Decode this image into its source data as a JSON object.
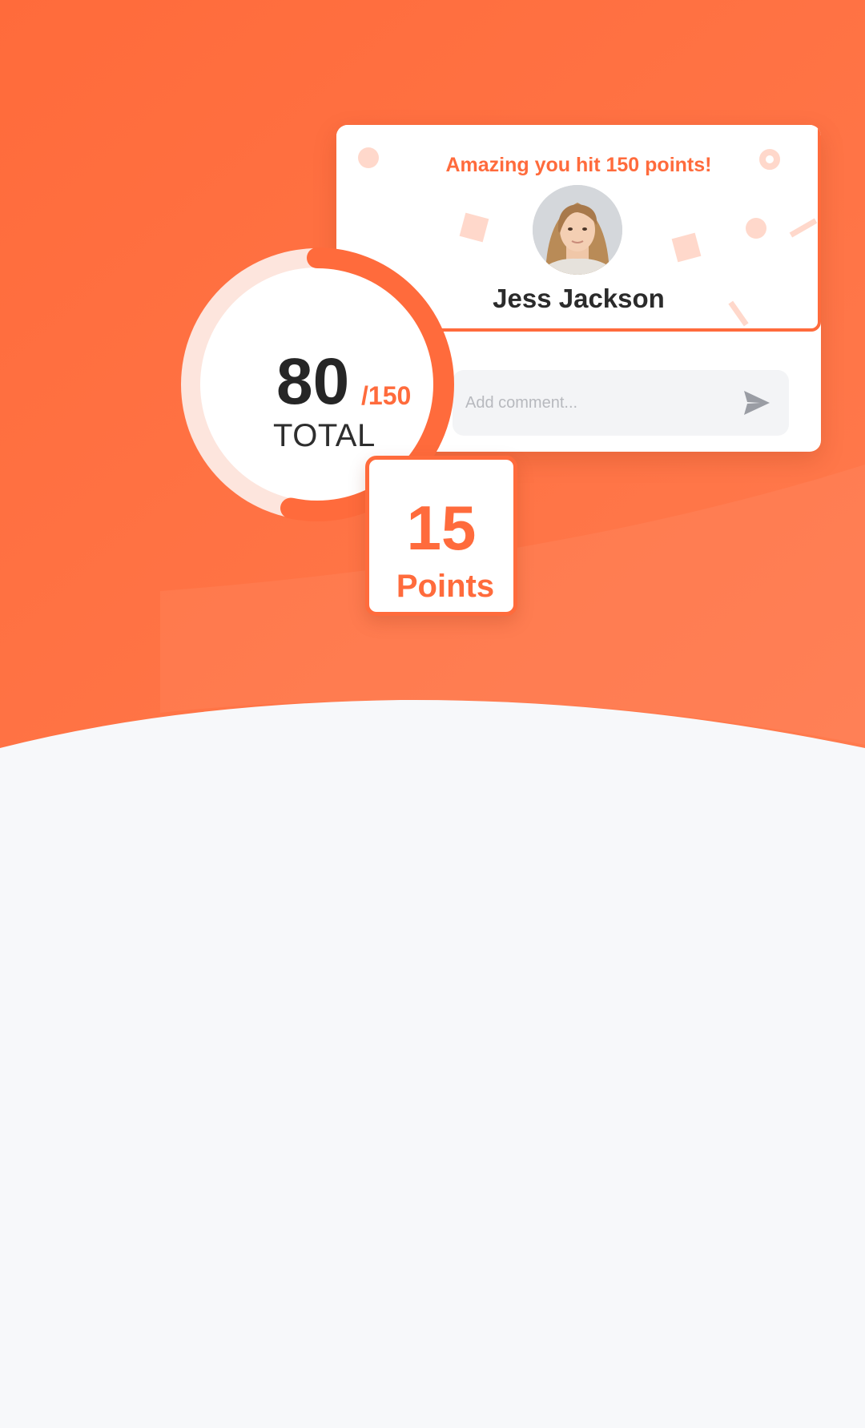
{
  "theme": {
    "accent": "#ff6b3c",
    "accent_light": "#ffd8cb",
    "background_light": "#f7f8fa"
  },
  "celebration_card": {
    "headline": "Amazing you hit 150 points!",
    "user_name": "Jess Jackson",
    "avatar_icon": "user-avatar-photo",
    "comment_placeholder": "Add comment...",
    "send_icon": "send-icon"
  },
  "progress": {
    "current": "80",
    "total": "/150",
    "label": "TOTAL",
    "fraction": 0.5333
  },
  "points_badge": {
    "value": "15",
    "label": "Points"
  }
}
